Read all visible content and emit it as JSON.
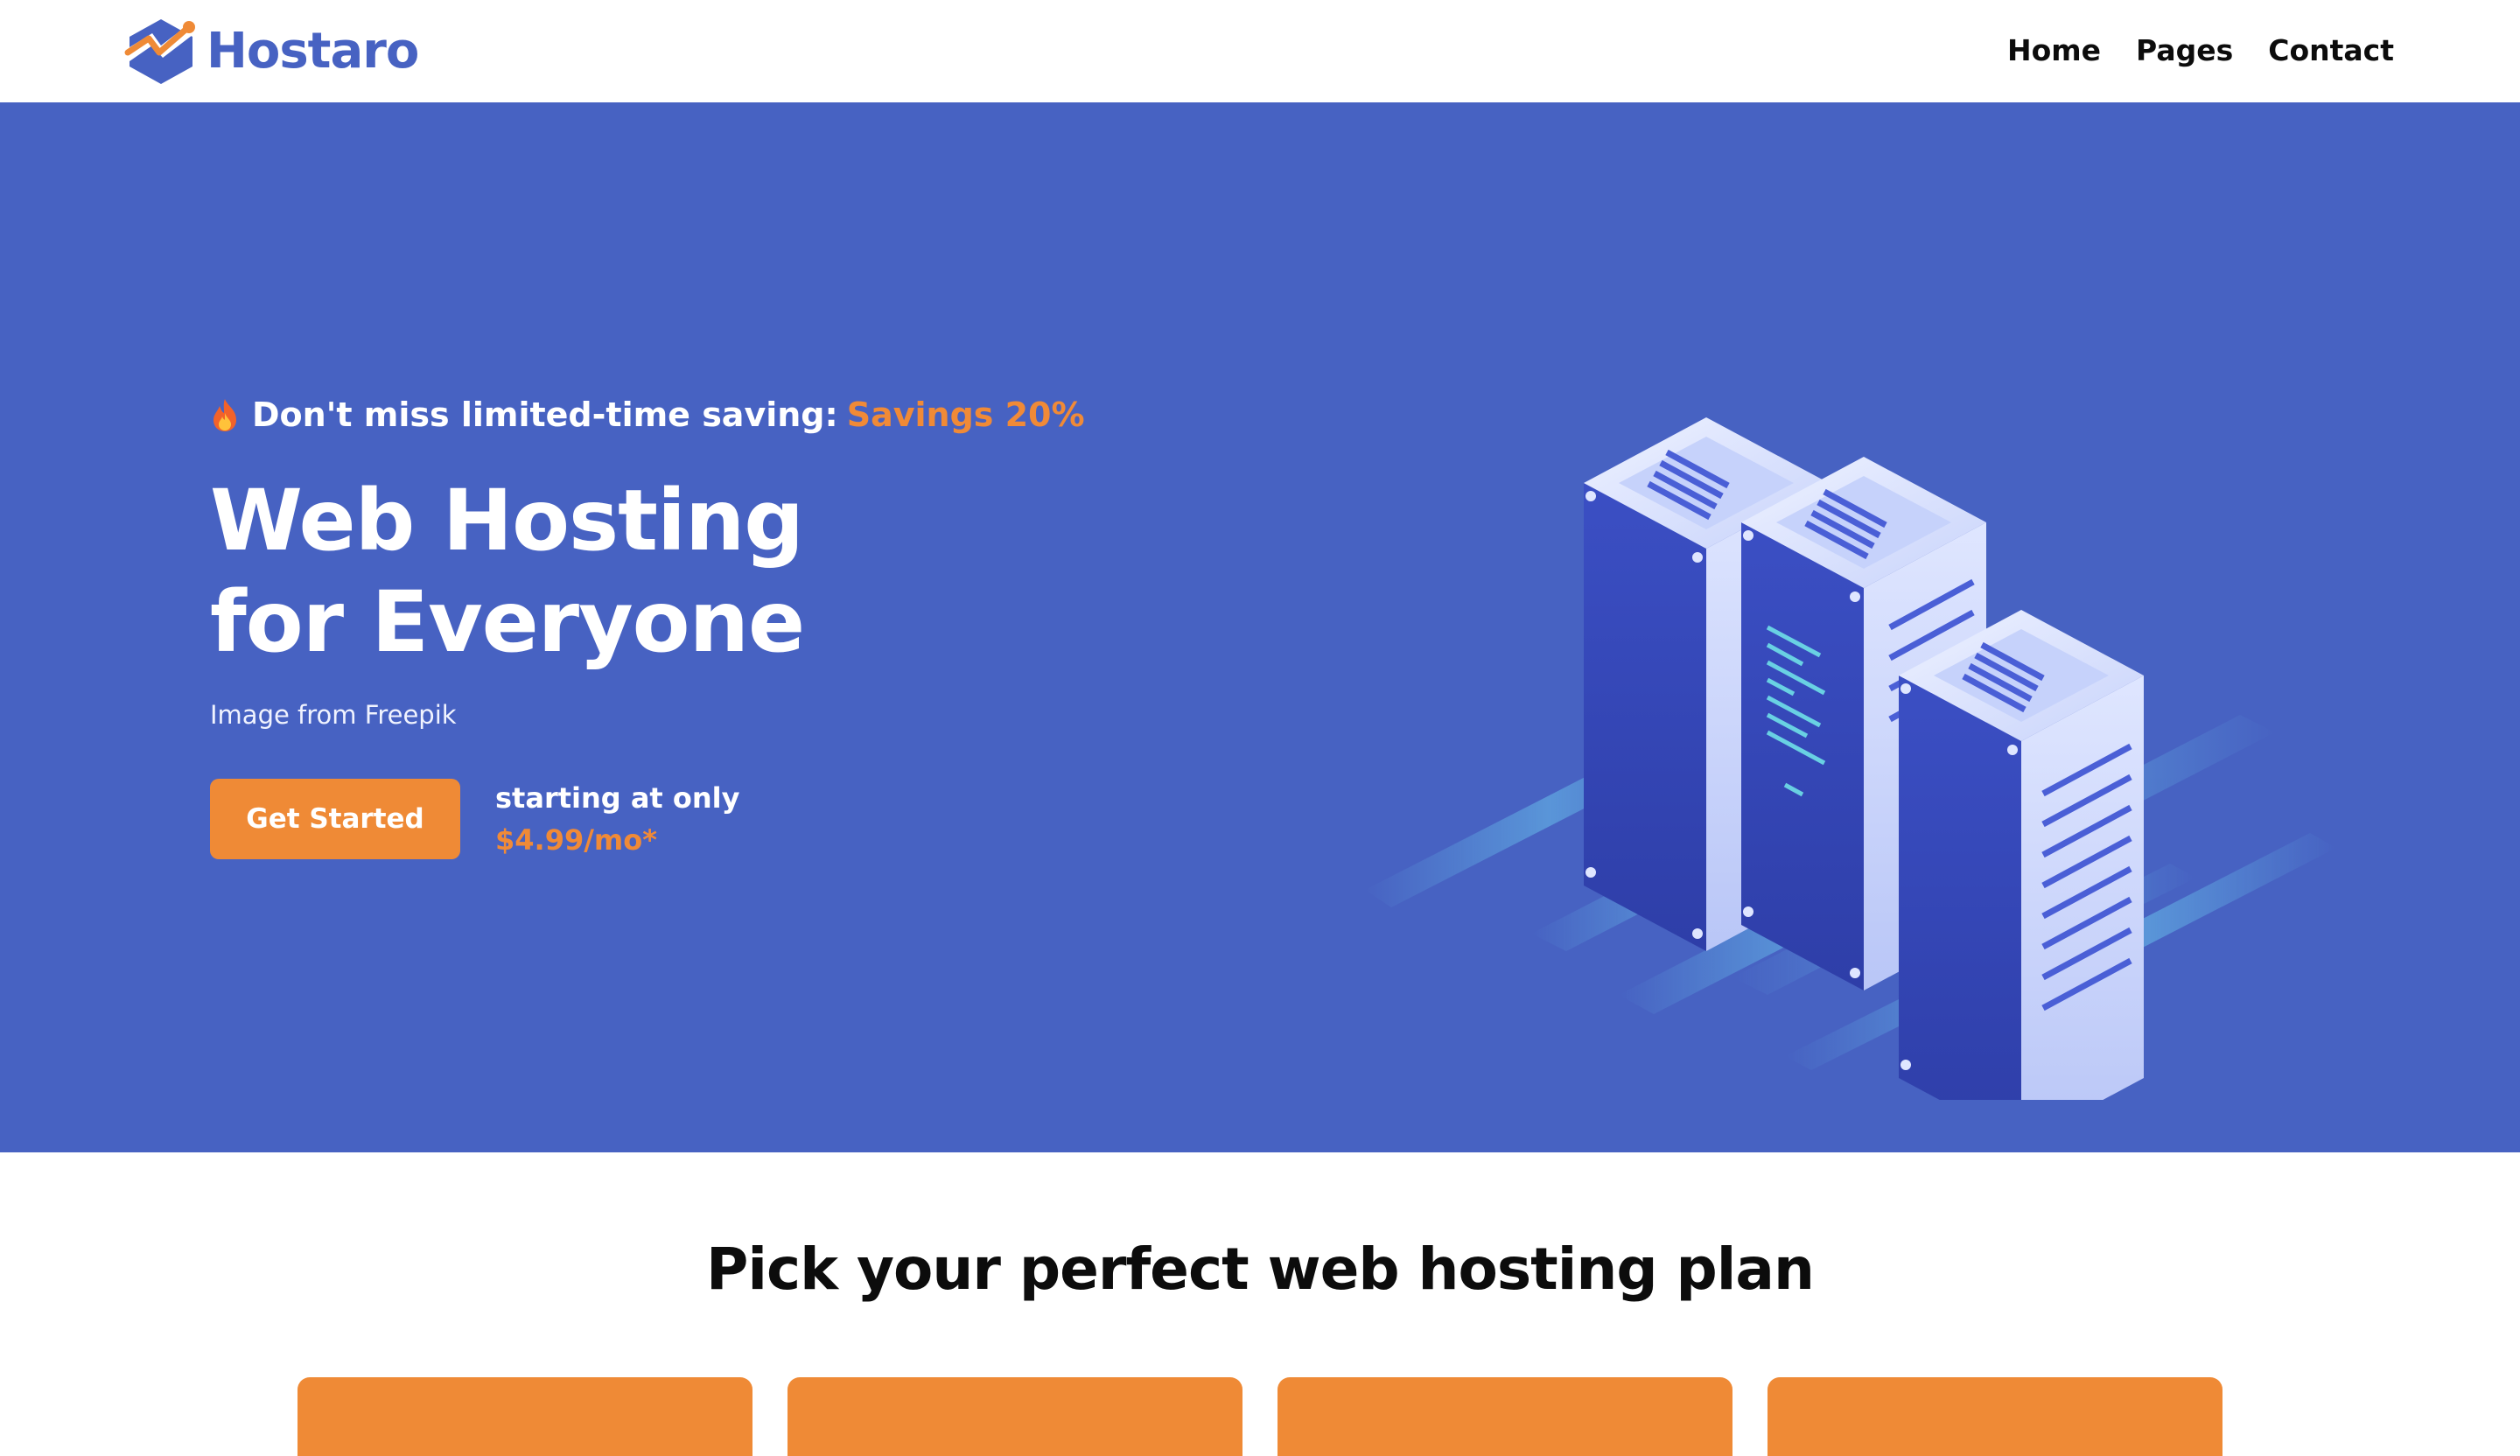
{
  "brand": {
    "name": "Hostaro",
    "color": "#4762c2",
    "accent": "#ef8a36",
    "icon": "logo-mark-icon"
  },
  "nav": {
    "items": [
      {
        "label": "Home"
      },
      {
        "label": "Pages"
      },
      {
        "label": "Contact"
      }
    ]
  },
  "hero": {
    "background": "#4762c2",
    "promo": {
      "icon": "fire-icon",
      "text": "Don't miss limited-time saving:",
      "highlight": "Savings 20%"
    },
    "title_line1": "Web Hosting",
    "title_line2": "for Everyone",
    "credit": "Image from Freepik",
    "cta_label": "Get Started",
    "price_prefix": "starting at only",
    "price": "$4.99/mo*",
    "illustration": "server-racks-illustration"
  },
  "plans": {
    "title": "Pick your perfect web hosting plan",
    "card_count": 4
  }
}
